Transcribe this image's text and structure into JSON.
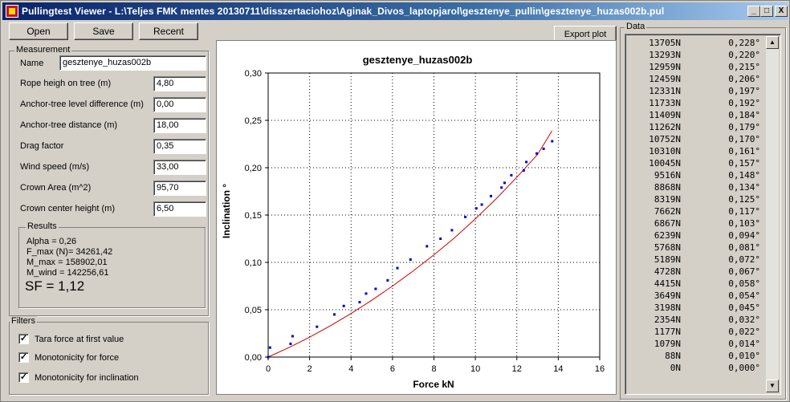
{
  "window": {
    "title": "Pullingtest Viewer - L:\\Teljes FMK mentes 20130711\\disszertaciohoz\\Aginak_Divos_laptopjarol\\gesztenye_pullin\\gesztenye_huzas002b.pul",
    "minimize": "_",
    "maximize": "□",
    "close": "X"
  },
  "toolbar": {
    "open_label": "Open",
    "save_label": "Save",
    "recent_label": "Recent",
    "export_label": "Export plot"
  },
  "measurement": {
    "legend": "Measurement",
    "name_label": "Name",
    "name_value": "gesztenye_huzas002b",
    "fields": [
      {
        "label": "Rope heigh on tree (m)",
        "value": "4,80"
      },
      {
        "label": "Anchor-tree level difference (m)",
        "value": "0,00"
      },
      {
        "label": "Anchor-tree distance (m)",
        "value": "18,00"
      },
      {
        "label": "Drag factor",
        "value": "0,35"
      },
      {
        "label": "Wind speed (m/s)",
        "value": "33,00"
      },
      {
        "label": "Crown Area (m^2)",
        "value": "95,70"
      },
      {
        "label": "Crown center height (m)",
        "value": "6,50"
      }
    ],
    "results": {
      "legend": "Results",
      "alpha": "Alpha = 0,26",
      "fmax": "F_max (N)= 34261,42",
      "mmax": "M_max = 158902,01",
      "mwind": "M_wind = 142256,61",
      "sf": "SF = 1,12"
    }
  },
  "filters": {
    "legend": "Filters",
    "items": [
      {
        "label": "Tara force at first value",
        "checked": true
      },
      {
        "label": "Monotonicity for force",
        "checked": true
      },
      {
        "label": "Monotonicity for inclination",
        "checked": true
      }
    ]
  },
  "data_panel": {
    "legend": "Data",
    "rows": [
      {
        "force": "13705N",
        "angle": "0,228°"
      },
      {
        "force": "13293N",
        "angle": "0,220°"
      },
      {
        "force": "12959N",
        "angle": "0,215°"
      },
      {
        "force": "12459N",
        "angle": "0,206°"
      },
      {
        "force": "12331N",
        "angle": "0,197°"
      },
      {
        "force": "11733N",
        "angle": "0,192°"
      },
      {
        "force": "11409N",
        "angle": "0,184°"
      },
      {
        "force": "11262N",
        "angle": "0,179°"
      },
      {
        "force": "10752N",
        "angle": "0,170°"
      },
      {
        "force": "10310N",
        "angle": "0,161°"
      },
      {
        "force": "10045N",
        "angle": "0,157°"
      },
      {
        "force": "9516N",
        "angle": "0,148°"
      },
      {
        "force": "8868N",
        "angle": "0,134°"
      },
      {
        "force": "8319N",
        "angle": "0,125°"
      },
      {
        "force": "7662N",
        "angle": "0,117°"
      },
      {
        "force": "6867N",
        "angle": "0,103°"
      },
      {
        "force": "6239N",
        "angle": "0,094°"
      },
      {
        "force": "5768N",
        "angle": "0,081°"
      },
      {
        "force": "5189N",
        "angle": "0,072°"
      },
      {
        "force": "4728N",
        "angle": "0,067°"
      },
      {
        "force": "4415N",
        "angle": "0,058°"
      },
      {
        "force": "3649N",
        "angle": "0,054°"
      },
      {
        "force": "3198N",
        "angle": "0,045°"
      },
      {
        "force": "2354N",
        "angle": "0,032°"
      },
      {
        "force": "1177N",
        "angle": "0,022°"
      },
      {
        "force": "1079N",
        "angle": "0,014°"
      },
      {
        "force": "88N",
        "angle": "0,010°"
      },
      {
        "force": "0N",
        "angle": "0,000°"
      }
    ]
  },
  "chart_data": {
    "type": "scatter",
    "title": "gesztenye_huzas002b",
    "xlabel": "Force  kN",
    "ylabel": "Inclination  °",
    "xlim": [
      0,
      16
    ],
    "ylim": [
      0,
      0.3
    ],
    "x_ticks": [
      "0",
      "2",
      "4",
      "6",
      "8",
      "10",
      "12",
      "14",
      "16"
    ],
    "y_ticks": [
      "0,00",
      "0,05",
      "0,10",
      "0,15",
      "0,20",
      "0,25",
      "0,30"
    ],
    "grid": true,
    "series": [
      {
        "kind": "points",
        "color": "#0000cc",
        "points": [
          [
            13.705,
            0.228
          ],
          [
            13.293,
            0.22
          ],
          [
            12.959,
            0.215
          ],
          [
            12.459,
            0.206
          ],
          [
            12.331,
            0.197
          ],
          [
            11.733,
            0.192
          ],
          [
            11.409,
            0.184
          ],
          [
            11.262,
            0.179
          ],
          [
            10.752,
            0.17
          ],
          [
            10.31,
            0.161
          ],
          [
            10.045,
            0.157
          ],
          [
            9.516,
            0.148
          ],
          [
            8.868,
            0.134
          ],
          [
            8.319,
            0.125
          ],
          [
            7.662,
            0.117
          ],
          [
            6.867,
            0.103
          ],
          [
            6.239,
            0.094
          ],
          [
            5.768,
            0.081
          ],
          [
            5.189,
            0.072
          ],
          [
            4.728,
            0.067
          ],
          [
            4.415,
            0.058
          ],
          [
            3.649,
            0.054
          ],
          [
            3.198,
            0.045
          ],
          [
            2.354,
            0.032
          ],
          [
            1.177,
            0.022
          ],
          [
            1.079,
            0.014
          ],
          [
            0.088,
            0.01
          ],
          [
            0.0,
            0.0
          ]
        ]
      },
      {
        "kind": "fit-curve",
        "color": "#cc0000",
        "points": [
          [
            0,
            0.0
          ],
          [
            1,
            0.01
          ],
          [
            2,
            0.021
          ],
          [
            3,
            0.033
          ],
          [
            4,
            0.046
          ],
          [
            5,
            0.06
          ],
          [
            6,
            0.075
          ],
          [
            7,
            0.091
          ],
          [
            8,
            0.108
          ],
          [
            9,
            0.126
          ],
          [
            10,
            0.146
          ],
          [
            11,
            0.167
          ],
          [
            12,
            0.19
          ],
          [
            13,
            0.214
          ],
          [
            13.7,
            0.239
          ]
        ]
      }
    ]
  }
}
